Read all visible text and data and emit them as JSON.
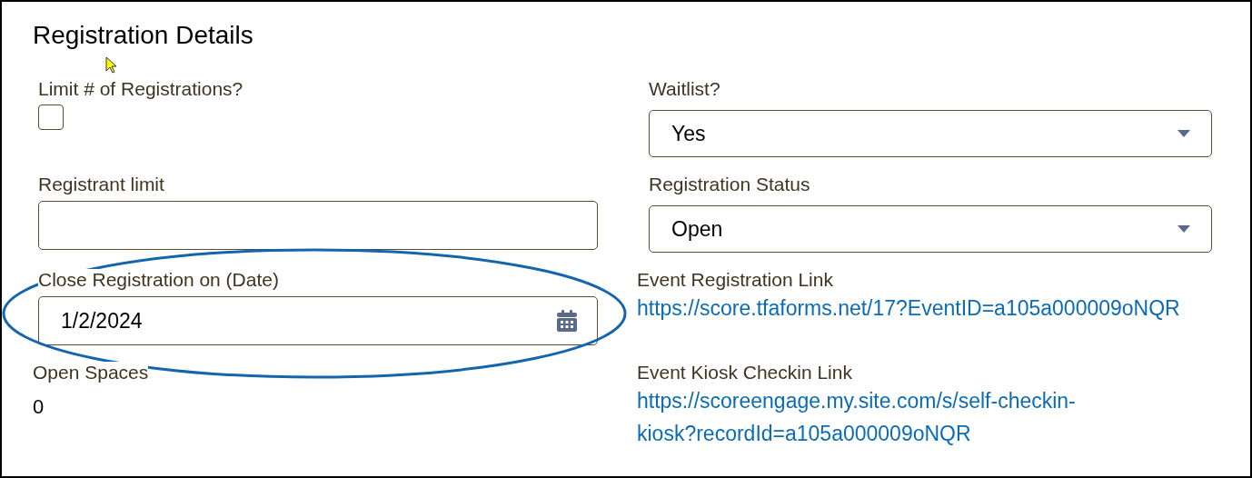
{
  "title": "Registration Details",
  "fields": [
    {
      "kind": "checkbox",
      "label": "Limit # of Registrations?",
      "checked": false
    },
    {
      "kind": "select",
      "label": "Waitlist?",
      "value": "Yes"
    },
    {
      "kind": "text",
      "label": "Registrant limit"
    },
    {
      "kind": "select",
      "label": "Registration Status",
      "value": "Open"
    },
    {
      "kind": "date",
      "label": "Close Registration on (Date)",
      "value": "1/2/2024"
    },
    {
      "kind": "link",
      "label": "Event Registration Link",
      "value": "https://score.tfaforms.net/17?EventID=a105a000009oNQR"
    },
    {
      "kind": "readonly",
      "label": "Open Spaces",
      "value": "0"
    },
    {
      "kind": "link",
      "label": "Event Kiosk Checkin Link",
      "value": "https://scoreengage.my.site.com/s/self-checkin-kiosk?recordId=a105a000009oNQR"
    }
  ]
}
